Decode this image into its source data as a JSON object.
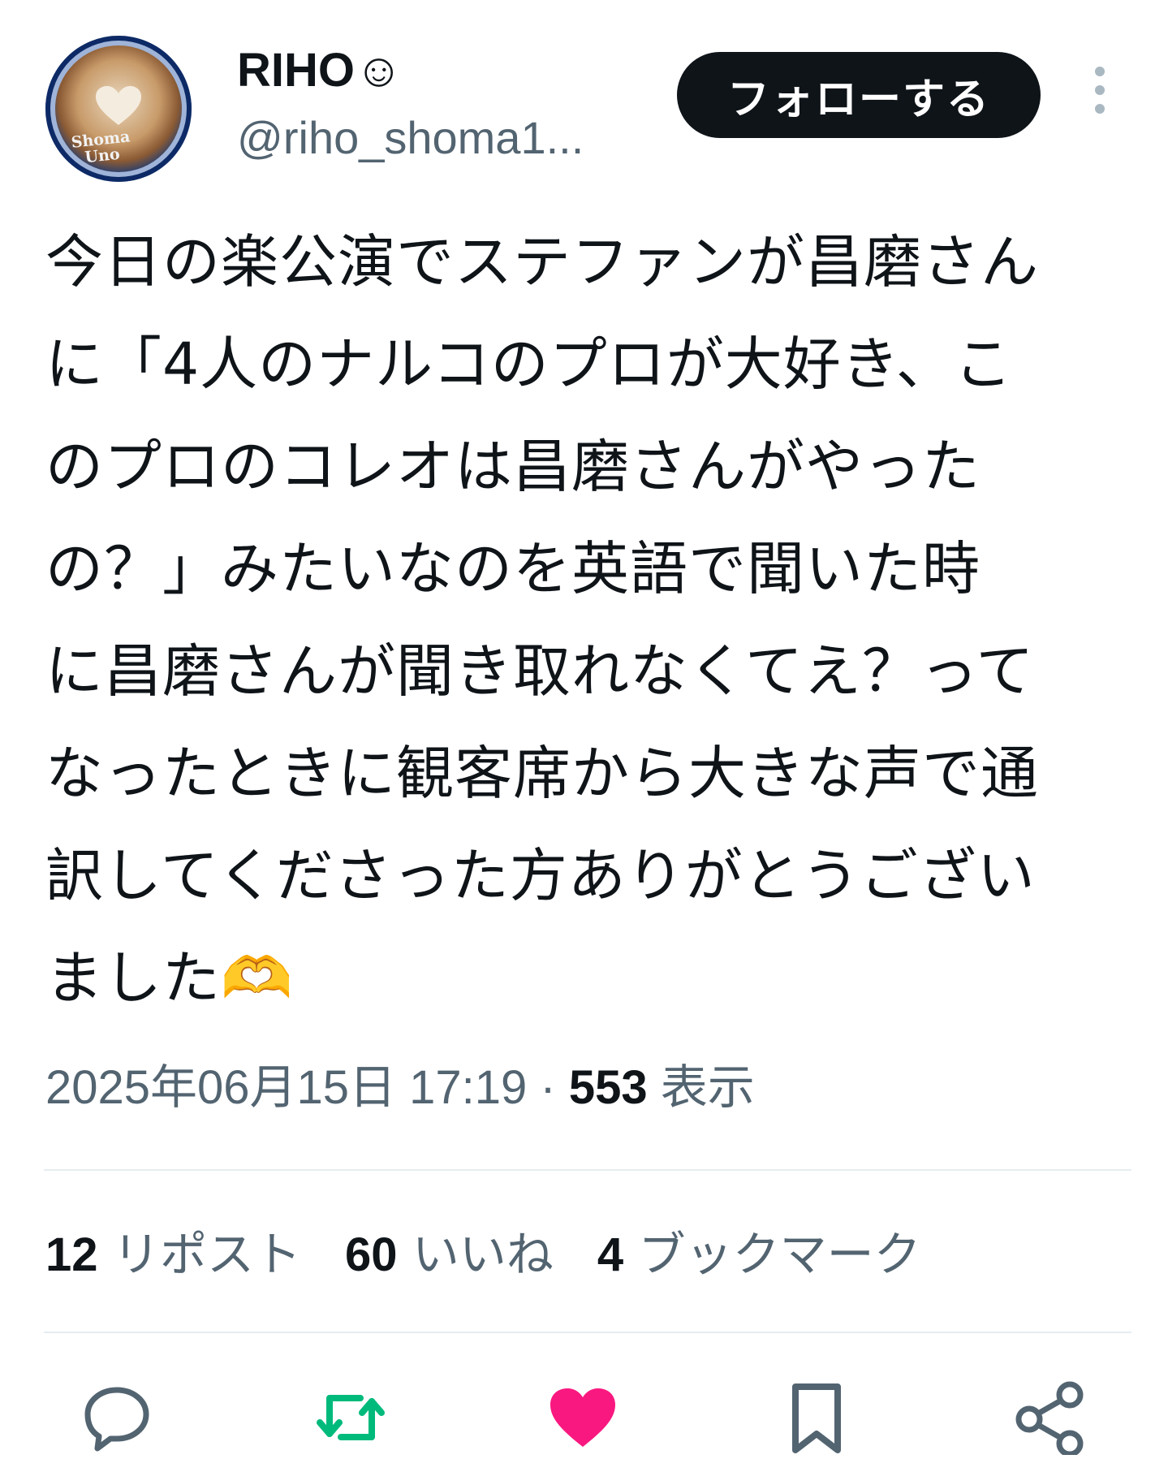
{
  "user": {
    "name": "RIHO☺",
    "handle": "@riho_shoma1...",
    "avatar_caption": [
      "Shoma",
      "Uno"
    ]
  },
  "header": {
    "follow_label": "フォローする"
  },
  "tweet": {
    "text": "今日の楽公演でステファンが昌磨さん\nに「4人のナルコのプロが大好き、こ\nのプロのコレオは昌磨さんがやった\nの？」みたいなのを英語で聞いた時\nに昌磨さんが聞き取れなくてえ？って\nなったときに観客席から大きな声で通\n訳してくださった方ありがとうござい\nました🫶"
  },
  "meta": {
    "timestamp": "2025年06月15日 17:19",
    "separator": " · ",
    "views_count": "553",
    "views_label": " 表示"
  },
  "stats": {
    "reposts_count": "12",
    "reposts_label": " リポスト",
    "likes_count": "60",
    "likes_label": " いいね",
    "bookmarks_count": "4",
    "bookmarks_label": " ブックマーク"
  },
  "actions": [
    {
      "icon": "reply-icon",
      "color": "#536471"
    },
    {
      "icon": "repost-icon",
      "color": "#00ba7c"
    },
    {
      "icon": "like-icon",
      "color": "#f91880"
    },
    {
      "icon": "bookmark-icon",
      "color": "#536471"
    },
    {
      "icon": "share-icon",
      "color": "#536471"
    }
  ]
}
